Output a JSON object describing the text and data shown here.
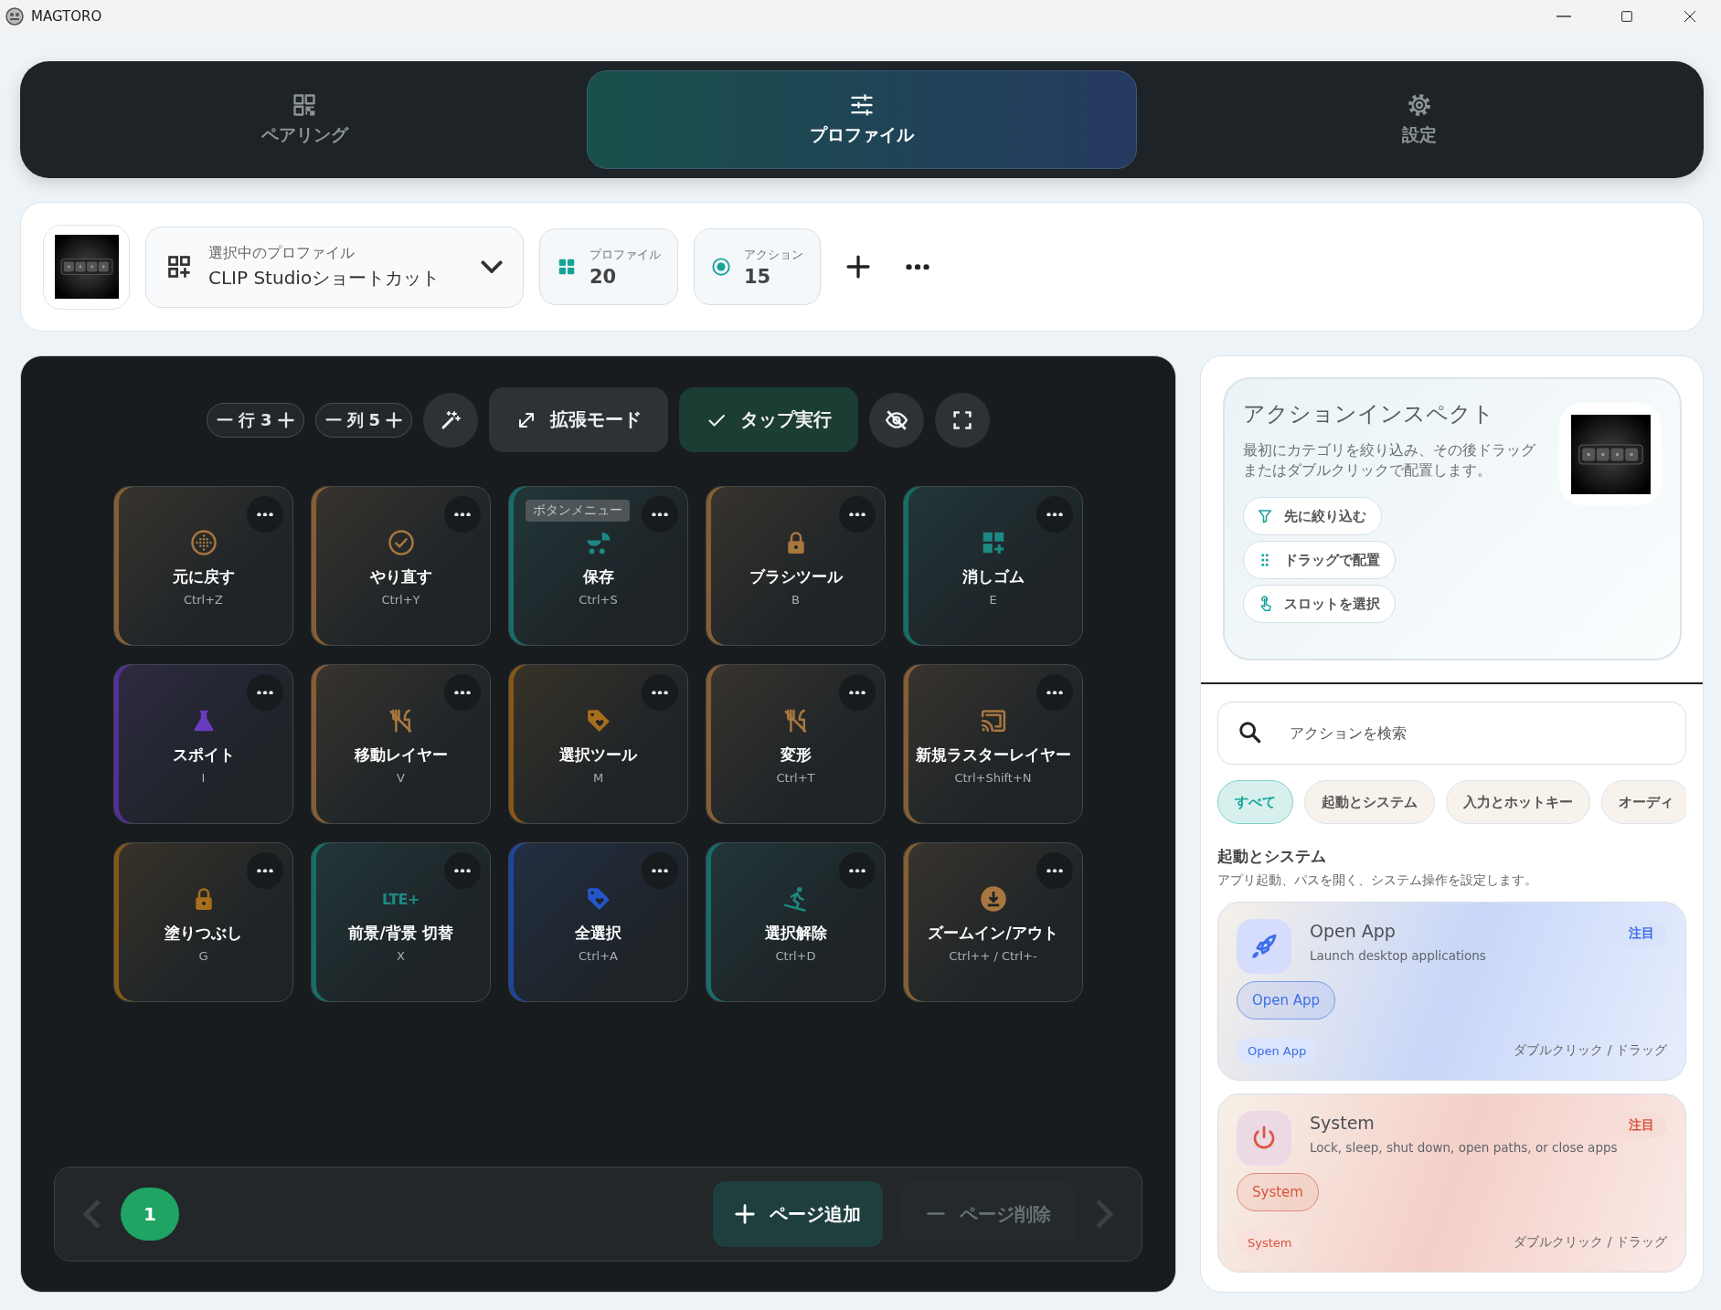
{
  "window": {
    "title": "MAGTORO"
  },
  "nav_tabs": [
    {
      "label": "ペアリング",
      "selected": false
    },
    {
      "label": "プロファイル",
      "selected": true
    },
    {
      "label": "設定",
      "selected": false
    }
  ],
  "profile_bar": {
    "selector": {
      "caption": "選択中のプロファイル",
      "value": "CLIP Studioショートカット"
    },
    "stats": [
      {
        "label": "プロファイル",
        "value": "20"
      },
      {
        "label": "アクション",
        "value": "15"
      }
    ]
  },
  "toolbar": {
    "steppers": [
      {
        "label": "行",
        "value": "3"
      },
      {
        "label": "列",
        "value": "5"
      }
    ],
    "modes": [
      {
        "label": "拡張モード",
        "on": false
      },
      {
        "label": "タップ実行",
        "on": true
      }
    ]
  },
  "buttons": [
    {
      "label": "元に戻す",
      "shortcut": "Ctrl+Z",
      "color": "#a8763f"
    },
    {
      "label": "やり直す",
      "shortcut": "Ctrl+Y",
      "color": "#a8763f"
    },
    {
      "label": "保存",
      "shortcut": "Ctrl+S",
      "color": "#1c8a83",
      "tooltip": "ボタンメニュー"
    },
    {
      "label": "ブラシツール",
      "shortcut": "B",
      "color": "#a8763f"
    },
    {
      "label": "消しゴム",
      "shortcut": "E",
      "color": "#1c8a83"
    },
    {
      "label": "スポイト",
      "shortcut": "I",
      "color": "#6a3bbf"
    },
    {
      "label": "移動レイヤー",
      "shortcut": "V",
      "color": "#a8763f"
    },
    {
      "label": "選択ツール",
      "shortcut": "M",
      "color": "#a86e1c"
    },
    {
      "label": "変形",
      "shortcut": "Ctrl+T",
      "color": "#a8763f"
    },
    {
      "label": "新規ラスターレイヤー",
      "shortcut": "Ctrl+Shift+N",
      "color": "#a8763f"
    },
    {
      "label": "塗りつぶし",
      "shortcut": "G",
      "color": "#a86e1c"
    },
    {
      "label": "前景/背景 切替",
      "shortcut": "X",
      "icon_text": "LTE+",
      "color": "#1c8a83"
    },
    {
      "label": "全選択",
      "shortcut": "Ctrl+A",
      "color": "#2456c8"
    },
    {
      "label": "選択解除",
      "shortcut": "Ctrl+D",
      "color": "#1c8a83"
    },
    {
      "label": "ズームイン/アウト",
      "shortcut": "Ctrl++ / Ctrl+-",
      "color": "#a8763f"
    }
  ],
  "pagination": {
    "pages": [
      {
        "label": "1",
        "selected": true
      }
    ],
    "add": "ページ追加",
    "remove": {
      "label": "ページ削除",
      "disabled": true
    }
  },
  "inspector": {
    "title": "アクションインスペクト",
    "description": "最初にカテゴリを絞り込み、その後ドラッグまたはダブルクリックで配置します。",
    "steps": [
      {
        "label": "先に絞り込む"
      },
      {
        "label": "ドラッグで配置"
      },
      {
        "label": "スロットを選択"
      }
    ]
  },
  "search": {
    "placeholder": "アクションを検索"
  },
  "filters": [
    {
      "label": "すべて",
      "selected": true
    },
    {
      "label": "起動とシステム",
      "selected": false
    },
    {
      "label": "入力とホットキー",
      "selected": false
    },
    {
      "label": "オーディ",
      "selected": false
    }
  ],
  "section": {
    "title": "起動とシステム",
    "description": "アプリ起動、パスを開く、システム操作を設定します。"
  },
  "actions": [
    {
      "title": "Open App",
      "description": "Launch desktop applications",
      "badge": "注目",
      "button": "Open App",
      "tag": "Open App",
      "hint": "ダブルクリック / ドラッグ",
      "color": "#3b6ee8"
    },
    {
      "title": "System",
      "description": "Lock, sleep, shut down, open paths, or close apps",
      "badge": "注目",
      "button": "System",
      "tag": "System",
      "hint": "ダブルクリック / ドラッグ",
      "color": "#d8553c"
    }
  ]
}
